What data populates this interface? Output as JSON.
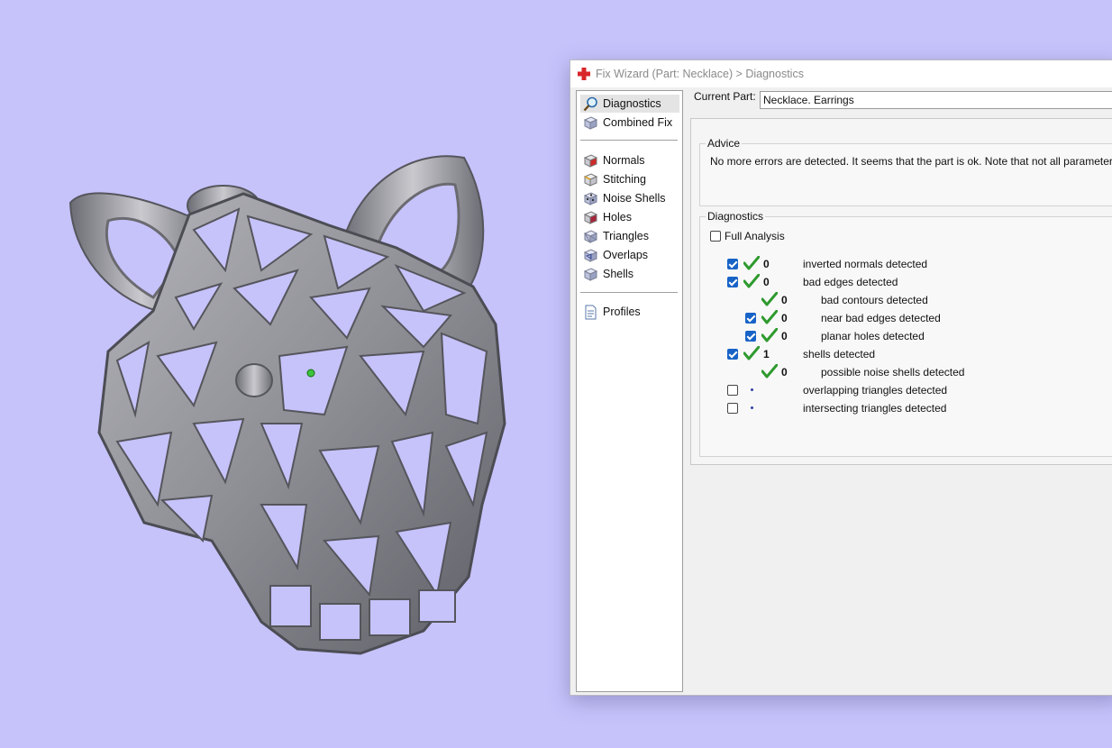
{
  "window": {
    "title": "Fix Wizard (Part: Necklace) > Diagnostics"
  },
  "nav": {
    "items_top": [
      {
        "label": "Diagnostics",
        "icon": "magnifier-icon",
        "selected": true
      },
      {
        "label": "Combined Fix",
        "icon": "cube-icon",
        "selected": false
      }
    ],
    "items_fix": [
      {
        "label": "Normals",
        "icon": "normals-cube-icon"
      },
      {
        "label": "Stitching",
        "icon": "stitching-cube-icon"
      },
      {
        "label": "Noise Shells",
        "icon": "noise-shells-cube-icon"
      },
      {
        "label": "Holes",
        "icon": "holes-cube-icon"
      },
      {
        "label": "Triangles",
        "icon": "triangles-cube-icon"
      },
      {
        "label": "Overlaps",
        "icon": "overlaps-cube-icon"
      },
      {
        "label": "Shells",
        "icon": "shells-cube-icon"
      }
    ],
    "profiles": {
      "label": "Profiles",
      "icon": "document-icon"
    }
  },
  "current_part": {
    "label": "Current Part:",
    "value": "Necklace. Earrings"
  },
  "advice": {
    "title": "Advice",
    "text": "No more errors are detected. It seems that the part is ok. Note that not all parameters were"
  },
  "diagnostics": {
    "title": "Diagnostics",
    "full_analysis": {
      "label": "Full Analysis",
      "checked": false
    },
    "rows": [
      {
        "label": "inverted normals detected",
        "count": "0",
        "checkbox": true,
        "checked": true,
        "status": "ok",
        "indent": 0
      },
      {
        "label": "bad edges detected",
        "count": "0",
        "checkbox": true,
        "checked": true,
        "status": "ok",
        "indent": 0
      },
      {
        "label": "bad contours detected",
        "count": "0",
        "checkbox": false,
        "checked": false,
        "status": "ok",
        "indent": 1
      },
      {
        "label": "near bad edges detected",
        "count": "0",
        "checkbox": true,
        "checked": true,
        "status": "ok",
        "indent": 1
      },
      {
        "label": "planar holes detected",
        "count": "0",
        "checkbox": true,
        "checked": true,
        "status": "ok",
        "indent": 1
      },
      {
        "label": "shells detected",
        "count": "1",
        "checkbox": true,
        "checked": true,
        "status": "ok",
        "indent": 0
      },
      {
        "label": "possible noise shells detected",
        "count": "0",
        "checkbox": false,
        "checked": false,
        "status": "ok",
        "indent": 1
      },
      {
        "label": "overlapping triangles detected",
        "count": "",
        "checkbox": true,
        "checked": false,
        "status": "pending",
        "indent": 0
      },
      {
        "label": "intersecting triangles detected",
        "count": "",
        "checkbox": true,
        "checked": false,
        "status": "pending",
        "indent": 0
      }
    ]
  },
  "colors": {
    "background": "#c6c3fb",
    "checkbox_blue": "#1863c7",
    "tick_green": "#2e9a2e",
    "model_grey": "#8c8c92"
  }
}
